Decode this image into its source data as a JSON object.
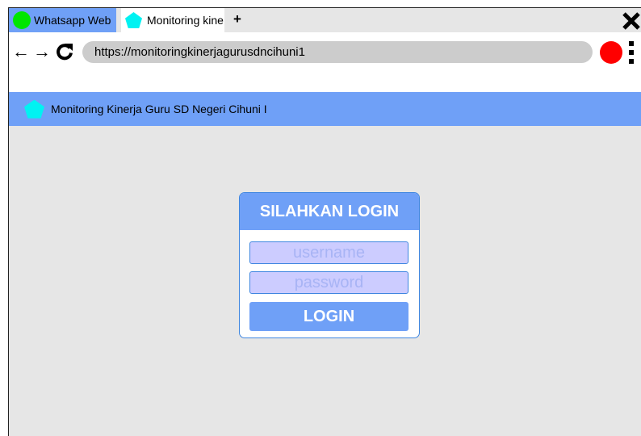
{
  "browser": {
    "tabs": [
      {
        "label": "Whatsapp Web",
        "icon": "green-circle-icon",
        "active": false
      },
      {
        "label": "Monitoring kine",
        "icon": "pentagon-icon",
        "active": true
      }
    ],
    "new_tab_label": "+",
    "url": "https://monitoringkinerjagurusdncihuni1",
    "nav": {
      "back": "←",
      "forward": "→"
    }
  },
  "page": {
    "header_title": "Monitoring Kinerja Guru SD Negeri Cihuni I"
  },
  "login": {
    "title": "SILAHKAN LOGIN",
    "username_placeholder": "username",
    "password_placeholder": "password",
    "button_label": "LOGIN"
  },
  "colors": {
    "accent": "#6fa0f7",
    "field_fill": "#ccccff",
    "background": "#e6e6e6",
    "record": "#ff0000",
    "tab_icon_green": "#00e600",
    "tab_icon_cyan": "#00f2f2"
  }
}
